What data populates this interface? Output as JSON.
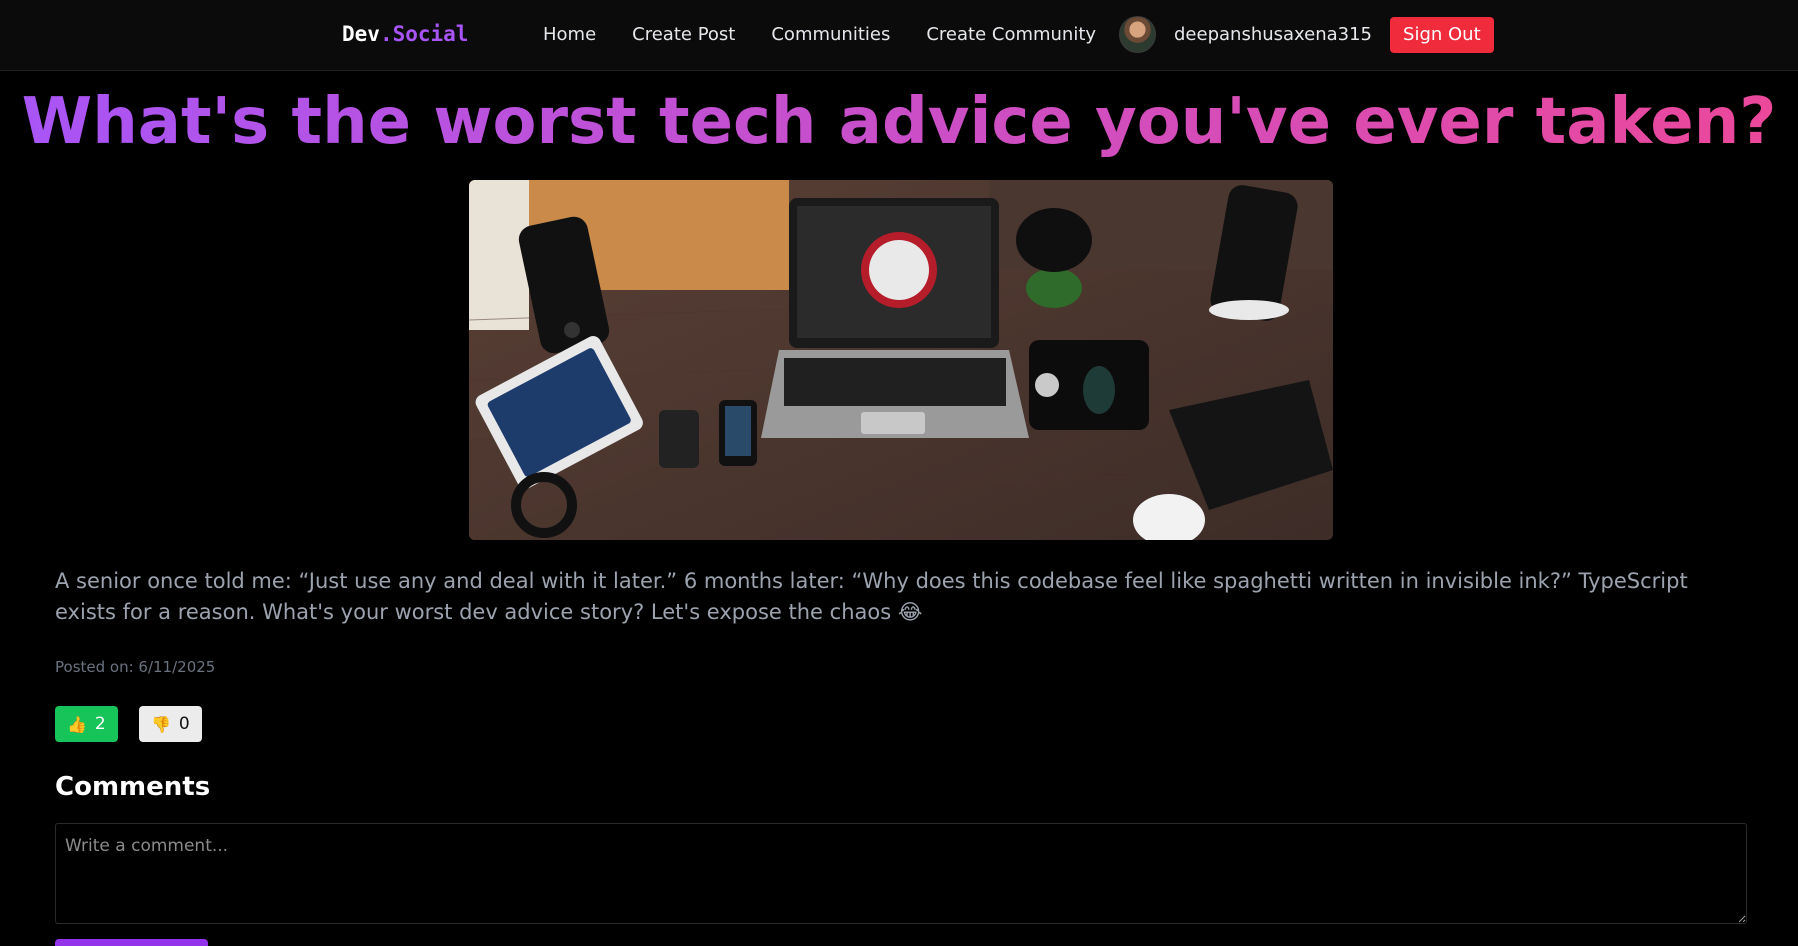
{
  "nav": {
    "logo_part1": "Dev",
    "logo_part2": ".Social",
    "links": [
      {
        "label": "Home"
      },
      {
        "label": "Create Post"
      },
      {
        "label": "Communities"
      },
      {
        "label": "Create Community"
      }
    ],
    "username": "deepanshusaxena315",
    "sign_out_label": "Sign Out"
  },
  "post": {
    "title": "What's the worst tech advice you've ever taken?",
    "image_alt": "Desk with laptop, tablet, phones and speakers",
    "body": "A senior once told me: “Just use any and deal with it later.” 6 months later: “Why does this codebase feel like spaghetti written in invisible ink?” TypeScript exists for a reason. What's your worst dev advice story? Let's expose the chaos 😂",
    "posted_on": "Posted on: 6/11/2025",
    "likes": "2",
    "dislikes": "0",
    "like_icon": "👍",
    "dislike_icon": "👎"
  },
  "comments": {
    "heading": "Comments",
    "placeholder": "Write a comment..."
  },
  "colors": {
    "accent": "#a855f7",
    "title_gradient_end": "#ec4899",
    "sign_out": "#ef2b3c",
    "like": "#16c45a"
  }
}
